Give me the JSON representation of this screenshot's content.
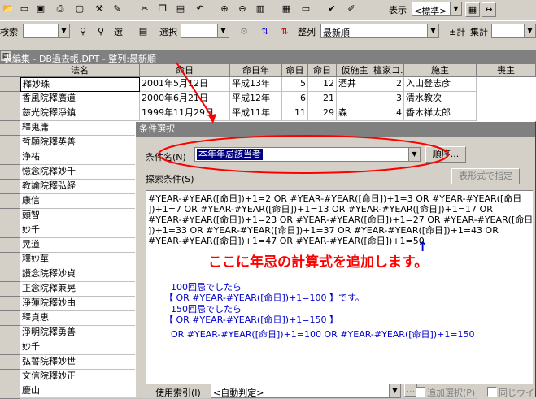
{
  "toolbar1": {
    "icons": [
      "folder-open-icon",
      "folder-icon",
      "save-icon",
      "print-icon",
      "print-preview-icon",
      "find-icon",
      "tool-icon",
      "cut-icon",
      "copy-icon",
      "paste-icon",
      "undo-icon",
      "zoom-in-icon",
      "zoom-out-icon",
      "chart-icon",
      "report-icon",
      "window-icon",
      "check-icon",
      "edit-icon"
    ],
    "view_label": "表示",
    "view_value": "<標準>"
  },
  "toolbar2": {
    "search_label": "検索",
    "select_label": "選",
    "select2_label": "選択",
    "sort_label": "整列",
    "sort_value": "最新順",
    "total_label": "集計",
    "total_btn_prefix": "±計"
  },
  "window_title": "表編集 - DB過去帳.DPT - 整列:最新順",
  "table": {
    "columns": [
      "法名",
      "命日",
      "命日年",
      "命日",
      "命日",
      "仮施主",
      "檀家コ...",
      "施主",
      "喪主"
    ],
    "rows": [
      [
        "釋妙珠",
        "2001年5月12日",
        "平成13年",
        "5",
        "12",
        "酒井",
        "2",
        "入山登志彦"
      ],
      [
        "香風院釋廣道",
        "2000年6月21日",
        "平成12年",
        "6",
        "21",
        "",
        "3",
        "清水教次"
      ],
      [
        "慈光院釋淨鎮",
        "1999年11月29日",
        "平成11年",
        "11",
        "29",
        "森",
        "4",
        "香木祥太郎"
      ],
      [
        "釋鬼庸",
        "",
        "",
        "",
        "",
        "",
        "",
        ""
      ],
      [
        "哲願院釋英善",
        "",
        "",
        "",
        "",
        "",
        "",
        ""
      ],
      [
        "浄祐",
        "",
        "",
        "",
        "",
        "",
        "",
        ""
      ],
      [
        "憶念院釋妙千",
        "",
        "",
        "",
        "",
        "",
        "",
        ""
      ],
      [
        "教諭院釋弘経",
        "",
        "",
        "",
        "",
        "",
        "",
        ""
      ],
      [
        "康信",
        "",
        "",
        "",
        "",
        "",
        "",
        ""
      ],
      [
        "頭智",
        "",
        "",
        "",
        "",
        "",
        "",
        ""
      ],
      [
        "妙千",
        "",
        "",
        "",
        "",
        "",
        "",
        ""
      ],
      [
        "晃道",
        "",
        "",
        "",
        "",
        "",
        "",
        ""
      ],
      [
        "釋妙華",
        "",
        "",
        "",
        "",
        "",
        "",
        ""
      ],
      [
        "讃念院釋妙貞",
        "",
        "",
        "",
        "",
        "",
        "",
        ""
      ],
      [
        "正念院釋兼晃",
        "",
        "",
        "",
        "",
        "",
        "",
        ""
      ],
      [
        "淨蓮院釋妙由",
        "",
        "",
        "",
        "",
        "",
        "",
        ""
      ],
      [
        "釋貞恵",
        "",
        "",
        "",
        "",
        "",
        "",
        ""
      ],
      [
        "淨明院釋勇善",
        "",
        "",
        "",
        "",
        "",
        "",
        ""
      ],
      [
        "妙千",
        "",
        "",
        "",
        "",
        "",
        "",
        ""
      ],
      [
        "弘誓院釋妙世",
        "",
        "",
        "",
        "",
        "",
        "",
        ""
      ],
      [
        "文信院釋妙正",
        "",
        "",
        "",
        "",
        "",
        "",
        ""
      ],
      [
        "慶山",
        "",
        "",
        "",
        "",
        "",
        "",
        ""
      ]
    ]
  },
  "dialog": {
    "title": "条件選択",
    "cond_name_label": "条件名(N)",
    "cond_name_value": "本年年忌該当者",
    "order_button": "順序...",
    "search_cond_label": "探索条件(S)",
    "expr_button": "表形式で指定",
    "formula_lines": [
      "#YEAR-#YEAR([命日])+1=2 OR #YEAR-#YEAR([命日])+1=3 OR #YEAR-#YEAR([命日",
      "])+1=7 OR #YEAR-#YEAR([命日])+1=13 OR #YEAR-#YEAR([命日])+1=17 OR",
      "#YEAR-#YEAR([命日])+1=23 OR #YEAR-#YEAR([命日])+1=27 OR #YEAR-#YEAR([命日",
      "])+1=33 OR #YEAR-#YEAR([命日])+1=37 OR #YEAR-#YEAR([命日])+1=43 OR",
      "#YEAR-#YEAR([命日])+1=47 OR #YEAR-#YEAR([命日])+1=50"
    ],
    "annotation": "ここに年忌の計算式を追加します。",
    "note1_a": "100回忌でしたら",
    "note1_b": "【 OR #YEAR-#YEAR([命日])+1=100 】です。",
    "note2_a": "150回忌でしたら",
    "note2_b": "【 OR #YEAR-#YEAR([命日])+1=150 】",
    "note3": "OR #YEAR-#YEAR([命日])+1=100 OR #YEAR-#YEAR([命日])+1=150",
    "index_label": "使用索引(I)",
    "index_value": "<自動判定>",
    "add_select_label": "追加選択(P)",
    "same_label": "同じウイ"
  },
  "colors": {
    "annotation_red": "#ff0000",
    "note_blue": "#0000cc",
    "highlight": "#000080"
  }
}
